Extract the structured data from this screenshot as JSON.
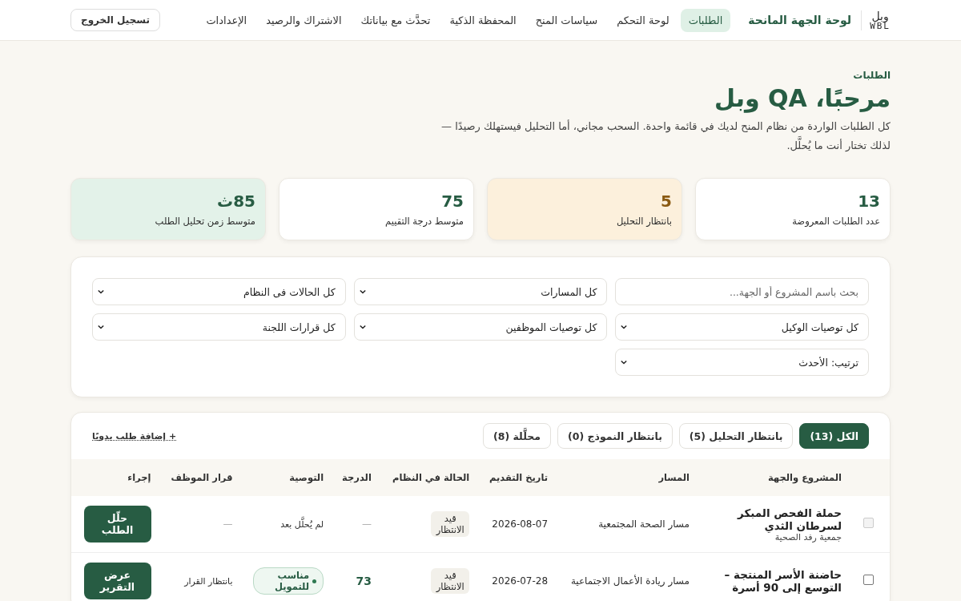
{
  "header": {
    "logo": {
      "arabic": "وبل",
      "latin": "WBL"
    },
    "portal_title": "لوحة الجهة المانحة",
    "nav": [
      {
        "label": "الطلبات",
        "selected": true
      },
      {
        "label": "لوحة التحكم",
        "selected": false
      },
      {
        "label": "سياسات المنح",
        "selected": false
      },
      {
        "label": "المحفظة الذكية",
        "selected": false
      },
      {
        "label": "تحدَّث مع بياناتك",
        "selected": false
      },
      {
        "label": "الاشتراك والرصيد",
        "selected": false
      },
      {
        "label": "الإعدادات",
        "selected": false
      }
    ],
    "logout": "تسجيل الخروج"
  },
  "page": {
    "eyebrow": "الطلبات",
    "title": "مرحبًا، QA وبل",
    "description": "كل الطلبات الواردة من نظام المنح لديك في قائمة واحدة. السحب مجاني، أما التحليل فيستهلك رصيدًا — لذلك تختار أنت ما يُحلَّل."
  },
  "stats": [
    {
      "value": "13",
      "label": "عدد الطلبات المعروضة",
      "kind": "plain"
    },
    {
      "value": "5",
      "label": "بانتظار التحليل",
      "kind": "warning"
    },
    {
      "value": "75",
      "label": "متوسط درجة التقييم",
      "kind": "plain"
    },
    {
      "value": "85ث",
      "label": "متوسط زمن تحليل الطلب",
      "kind": "success"
    }
  ],
  "filters": [
    {
      "kind": "search",
      "placeholder": "بحث باسم المشروع أو الجهة..."
    },
    {
      "kind": "select",
      "value": "كل المسارات"
    },
    {
      "kind": "select",
      "value": "كل الحالات فى النظام"
    },
    {
      "kind": "select",
      "value": "كل توصيات الوكيل"
    },
    {
      "kind": "select",
      "value": "كل توصيات الموظفين"
    },
    {
      "kind": "select",
      "value": "كل قرارات اللجنة"
    },
    {
      "kind": "select",
      "value": "ترتيب: الأحدث"
    }
  ],
  "table": {
    "tabs": [
      {
        "label": "الكل (13)",
        "selected": true
      },
      {
        "label": "بانتظار التحليل (5)",
        "selected": false
      },
      {
        "label": "بانتظار النموذج (0)",
        "selected": false
      },
      {
        "label": "محلَّلة (8)",
        "selected": false
      }
    ],
    "add_link": "+ إضافة طلب يدويًا",
    "columns": [
      "المشروع والجهة",
      "المسار",
      "تاريخ التقديم",
      "الحالة في النظام",
      "الدرجة",
      "التوصية",
      "قرار الموظف",
      "إجراء"
    ],
    "rows": [
      {
        "checked": false,
        "disabled": true,
        "project": "حملة الفحص المبكر لسرطان الثدي",
        "org": "جمعية رفد الصحية",
        "track": "مسار الصحة المجتمعية",
        "date": "2026-08-07",
        "status": "قيد الانتظار",
        "score": "—",
        "recommendation": {
          "kind": "text",
          "text": "لم يُحلَّل بعد"
        },
        "decision": "—",
        "action": "حلّل الطلب"
      },
      {
        "checked": false,
        "disabled": false,
        "project": "حاضنة الأسر المنتجة – التوسع إلى 90 أسرة",
        "track": "مسار ريادة الأعمال الاجتماعية",
        "date": "2026-07-28",
        "status": "قيد الانتظار",
        "score": "73",
        "recommendation": {
          "kind": "badge",
          "text": "مناسب للتمويل"
        },
        "decision": "بانتظار القرار",
        "action": "عرض التقرير"
      }
    ]
  }
}
